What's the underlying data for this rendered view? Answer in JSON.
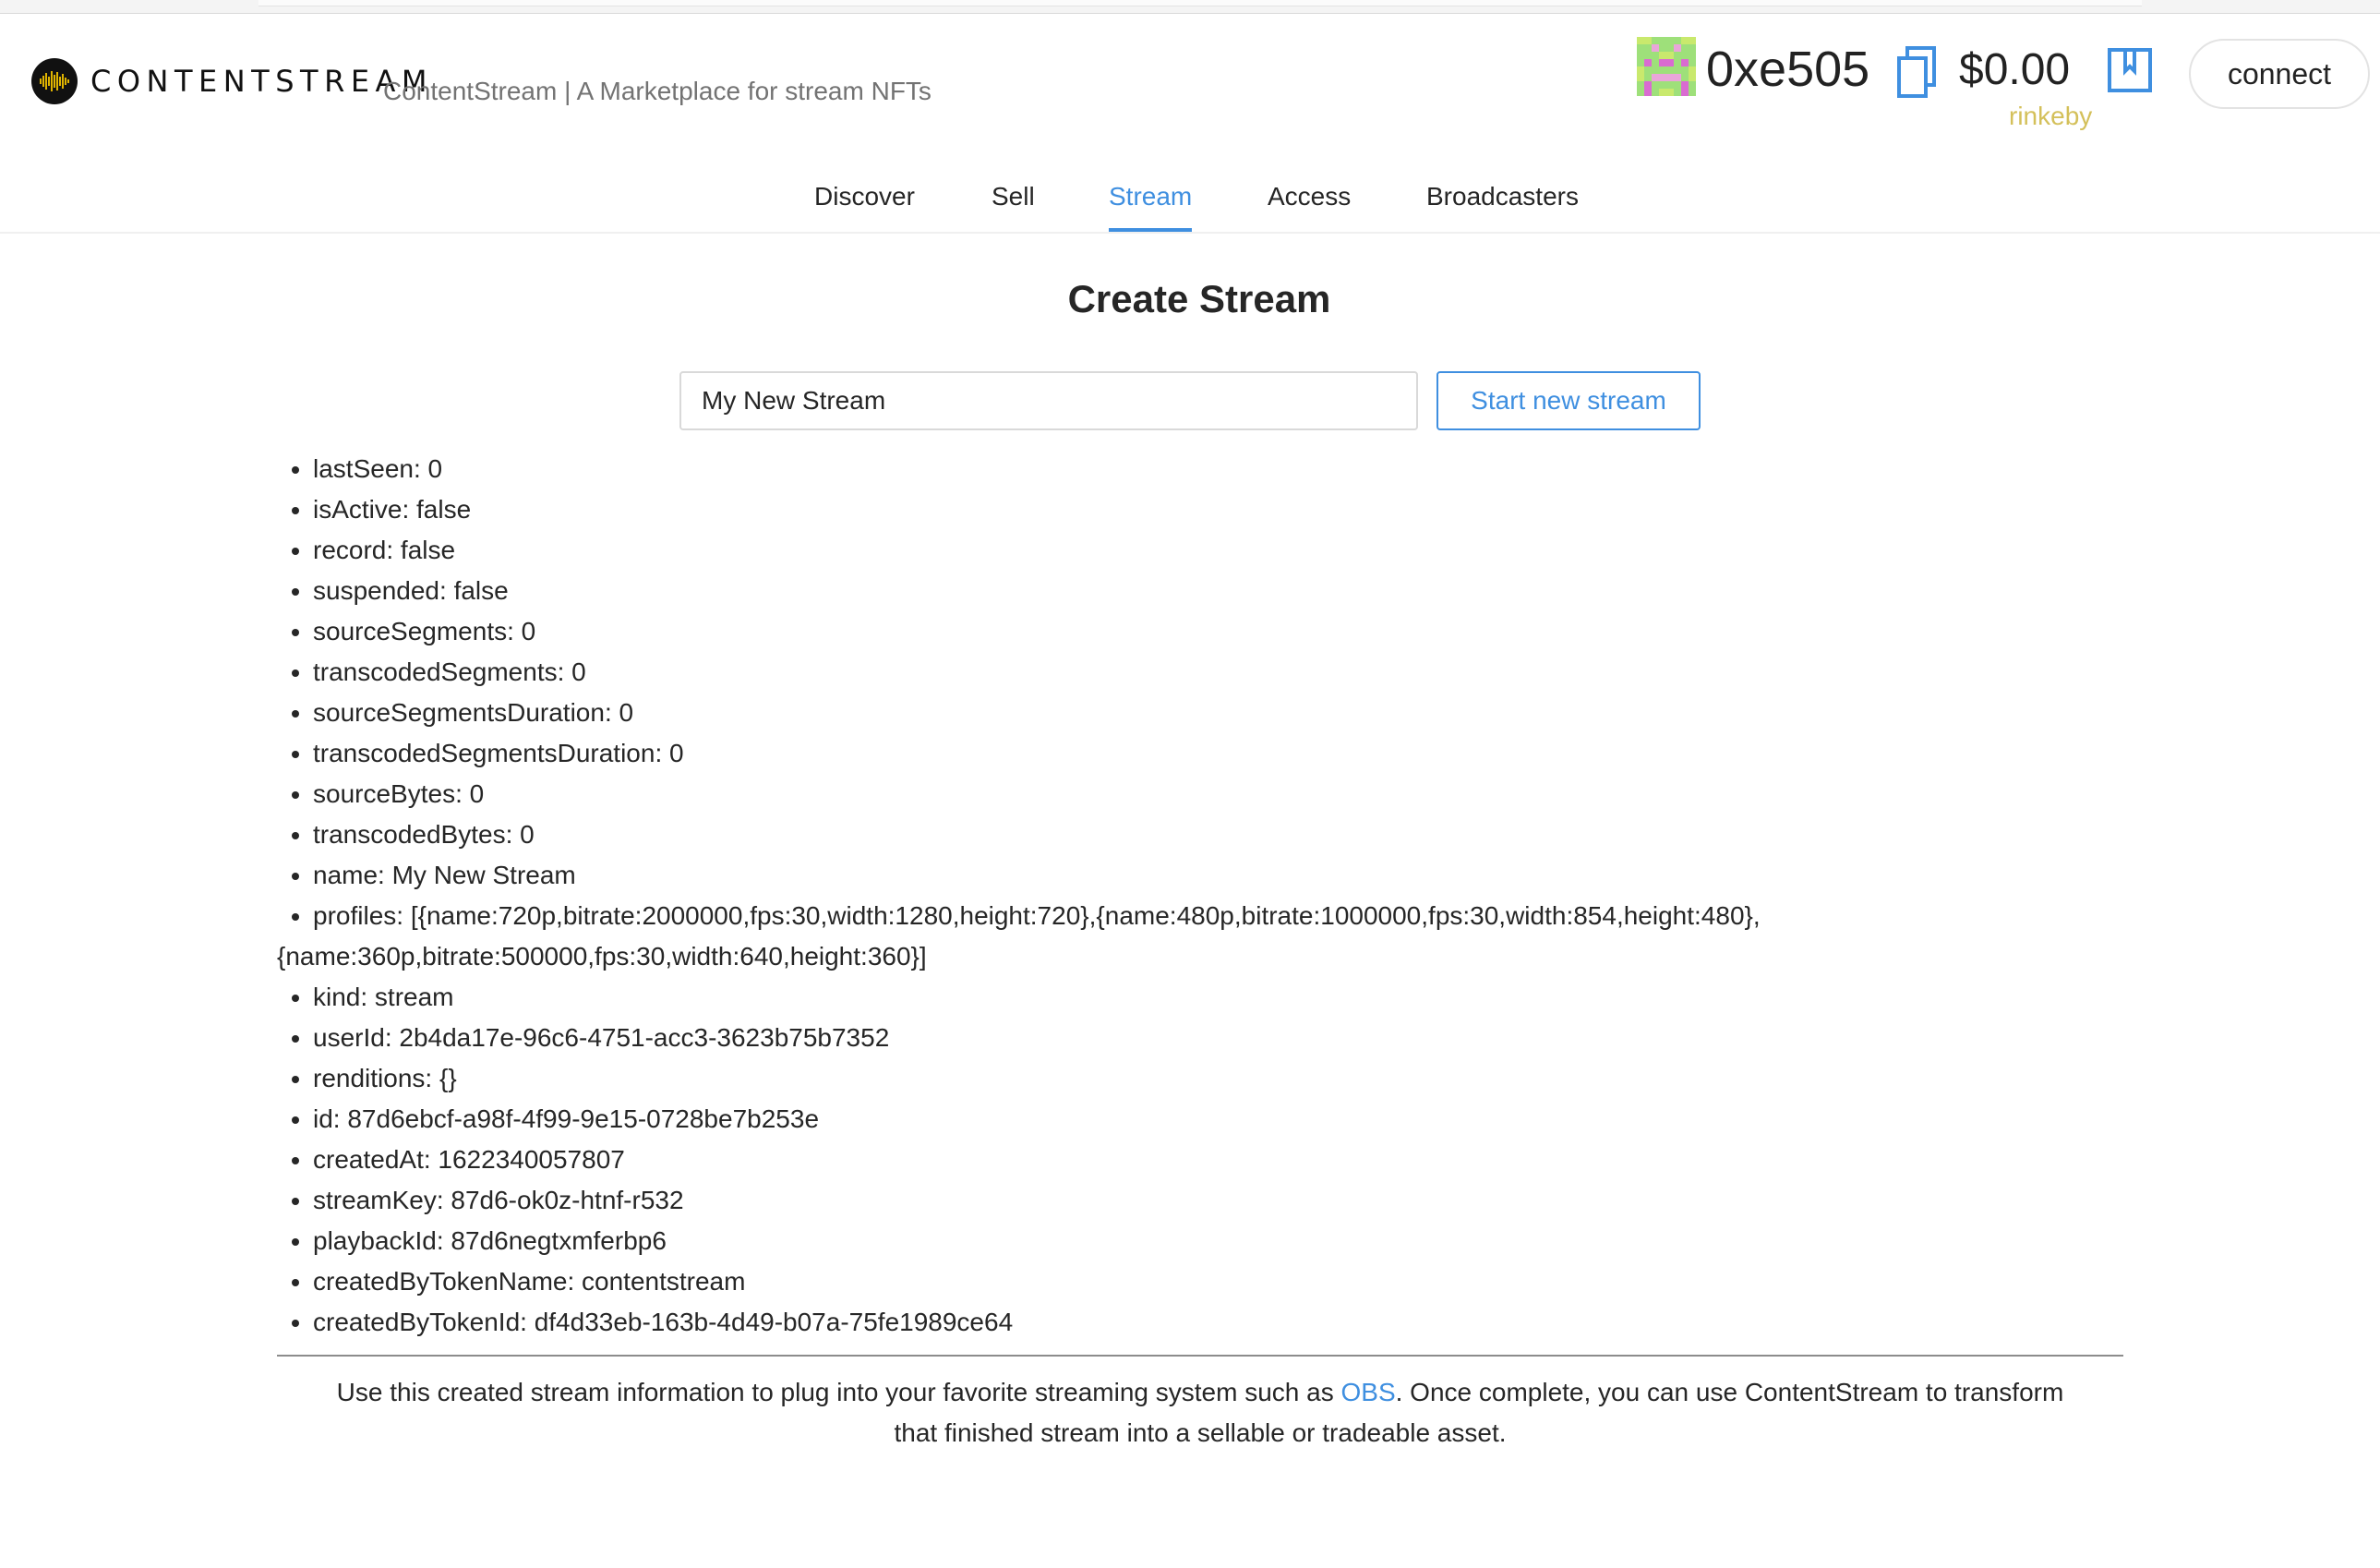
{
  "brand": {
    "logo_text": "CONTENTSTREAM",
    "tagline": "ContentStream | A Marketplace for stream NFTs"
  },
  "wallet": {
    "address": "0xe505",
    "balance": "$0.00",
    "network": "rinkeby",
    "connect_label": "connect"
  },
  "nav": {
    "items": [
      "Discover",
      "Sell",
      "Stream",
      "Access",
      "Broadcasters"
    ],
    "active": "Stream"
  },
  "page": {
    "title": "Create Stream"
  },
  "form": {
    "stream_name_value": "My New Stream",
    "start_button_label": "Start new stream"
  },
  "stream_info": [
    "lastSeen: 0",
    "isActive: false",
    "record: false",
    "suspended: false",
    "sourceSegments: 0",
    "transcodedSegments: 0",
    "sourceSegmentsDuration: 0",
    "transcodedSegmentsDuration: 0",
    "sourceBytes: 0",
    "transcodedBytes: 0",
    "name: My New Stream",
    "profiles: [{name:720p,bitrate:2000000,fps:30,width:1280,height:720},{name:480p,bitrate:1000000,fps:30,width:854,height:480},",
    "{name:360p,bitrate:500000,fps:30,width:640,height:360}]",
    "kind: stream",
    "userId: 2b4da17e-96c6-4751-acc3-3623b75b7352",
    "renditions: {}",
    "id: 87d6ebcf-a98f-4f99-9e15-0728be7b253e",
    "createdAt: 1622340057807",
    "streamKey: 87d6-ok0z-htnf-r532",
    "playbackId: 87d6negtxmferbp6",
    "createdByTokenName: contentstream",
    "createdByTokenId: df4d33eb-163b-4d49-b07a-75fe1989ce64"
  ],
  "footer": {
    "text_before": "Use this created stream information to plug into your favorite streaming system such as ",
    "link_text": "OBS",
    "text_after": ". Once complete, you can use ContentStream to transform",
    "line2": "that finished stream into a sellable or tradeable asset."
  },
  "colors": {
    "accent": "#3f8fe0",
    "network": "#d4c05a",
    "text": "#262626"
  },
  "icons": {
    "logo": "audio-waveform-icon",
    "avatar": "pixel-avatar-icon",
    "copy": "copy-icon",
    "wallet": "wallet-icon"
  }
}
